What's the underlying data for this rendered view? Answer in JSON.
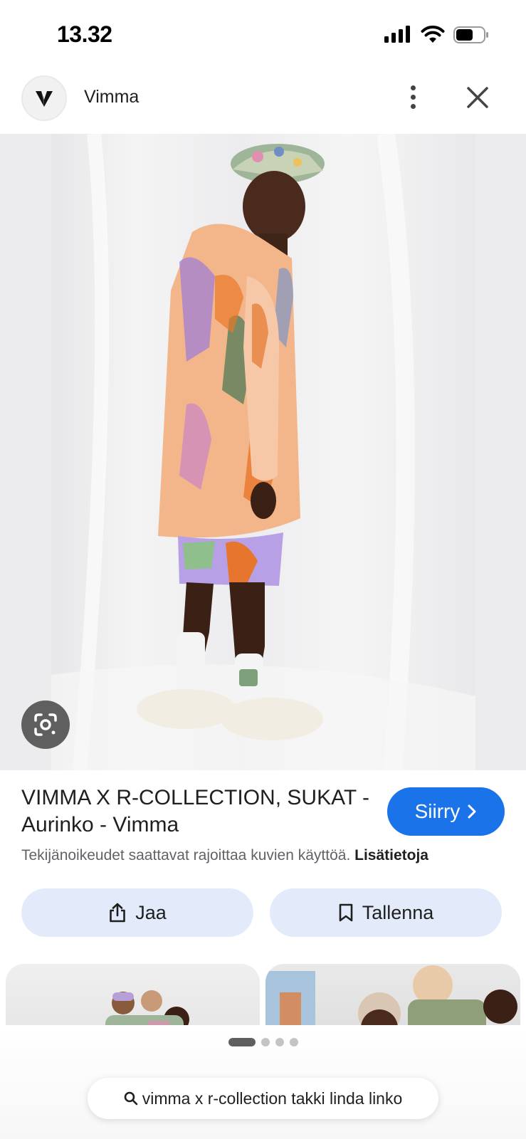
{
  "status_bar": {
    "time": "13.32",
    "icons": [
      "cellular-signal-icon",
      "wifi-icon",
      "battery-icon"
    ]
  },
  "header": {
    "site_name": "Vimma",
    "logo": "vimma-logo",
    "menu_icon": "more-vertical-icon",
    "close_icon": "close-icon"
  },
  "image": {
    "lens_icon": "google-lens-icon"
  },
  "result": {
    "title": "VIMMA X R-COLLECTION, SUKAT - Aurinko - Vimma",
    "visit_label": "Siirry",
    "copyright_text": "Tekijänoikeudet saattavat rajoittaa kuvien käyttöä.",
    "more_info_link": "Lisätietoja"
  },
  "actions": {
    "share_label": "Jaa",
    "save_label": "Tallenna"
  },
  "pager": {
    "total": 4,
    "current": 1
  },
  "search": {
    "query": "vimma x r-collection takki linda linko"
  },
  "colors": {
    "accent": "#1a73e8",
    "action_bg": "#e3ebfb",
    "muted_text": "#5f6368"
  }
}
